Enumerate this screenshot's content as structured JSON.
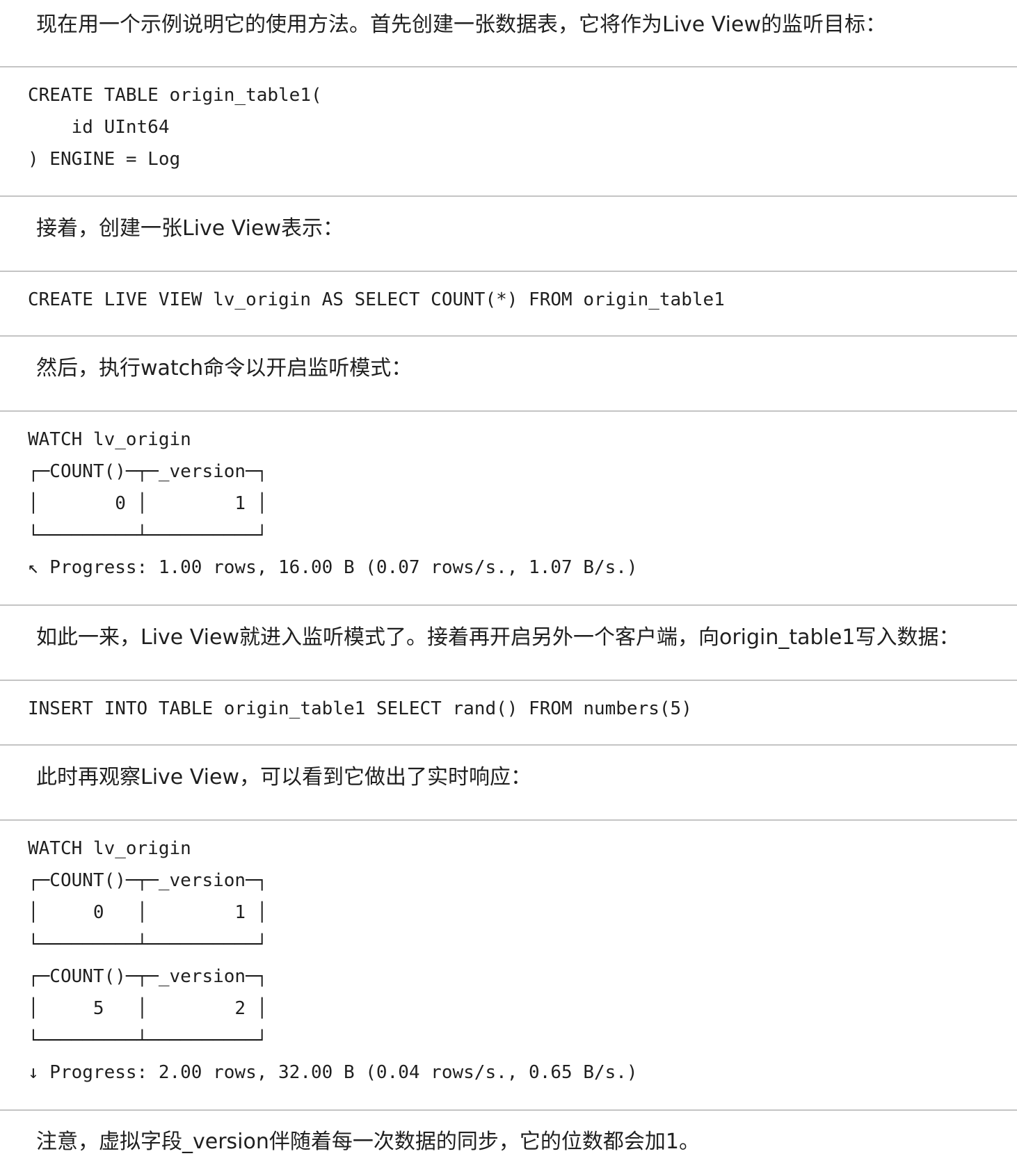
{
  "paragraphs": {
    "intro": "现在用一个示例说明它的使用方法。首先创建一张数据表，它将作为Live View的监听目标：",
    "create_view": "接着，创建一张Live View表示：",
    "watch_cmd": "然后，执行watch命令以开启监听模式：",
    "insert_note": "如此一来，Live View就进入监听模式了。接着再开启另外一个客户端，向origin_table1写入数据：",
    "observe": "此时再观察Live View，可以看到它做出了实时响应：",
    "version_note": "注意，虚拟字段_version伴随着每一次数据的同步，它的位数都会加1。"
  },
  "code_blocks": {
    "create_table": [
      "CREATE TABLE origin_table1(",
      "    id UInt64",
      ") ENGINE = Log"
    ],
    "create_live_view": [
      "CREATE LIVE VIEW lv_origin AS SELECT COUNT(*) FROM origin_table1"
    ],
    "watch_first": [
      "WATCH lv_origin",
      "┌─COUNT()─┬─_version─┐",
      "│       0 │        1 │",
      "└─────────┴──────────┘",
      "↖ Progress: 1.00 rows, 16.00 B (0.07 rows/s., 1.07 B/s.)"
    ],
    "insert": [
      "INSERT INTO TABLE origin_table1 SELECT rand() FROM numbers(5)"
    ],
    "watch_second": [
      "WATCH lv_origin",
      "┌─COUNT()─┬─_version─┐",
      "│     0   │        1 │",
      "└─────────┴──────────┘",
      "┌─COUNT()─┬─_version─┐",
      "│     5   │        2 │",
      "└─────────┴──────────┘",
      "↓ Progress: 2.00 rows, 32.00 B (0.04 rows/s., 0.65 B/s.)"
    ]
  }
}
